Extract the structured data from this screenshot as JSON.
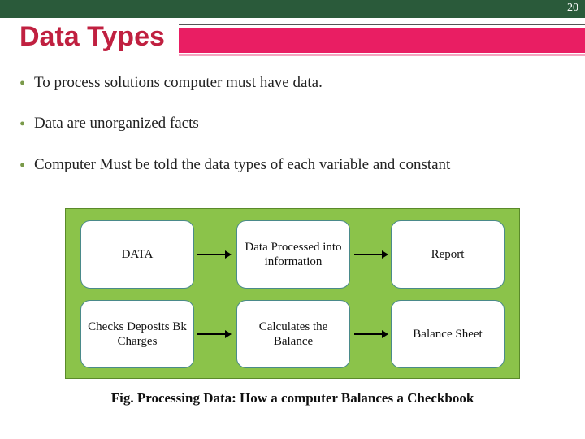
{
  "page_number": "20",
  "title": "Data Types",
  "bullets": [
    "To process solutions computer must have data.",
    "Data are unorganized facts",
    "Computer Must be told the data types of each variable and constant"
  ],
  "diagram": {
    "row1": {
      "c1": "DATA",
      "c2": "Data Processed into information",
      "c3": "Report"
    },
    "row2": {
      "c1": "Checks Deposits Bk Charges",
      "c2": "Calculates the Balance",
      "c3": "Balance Sheet"
    }
  },
  "caption": "Fig. Processing Data: How a computer Balances a Checkbook"
}
